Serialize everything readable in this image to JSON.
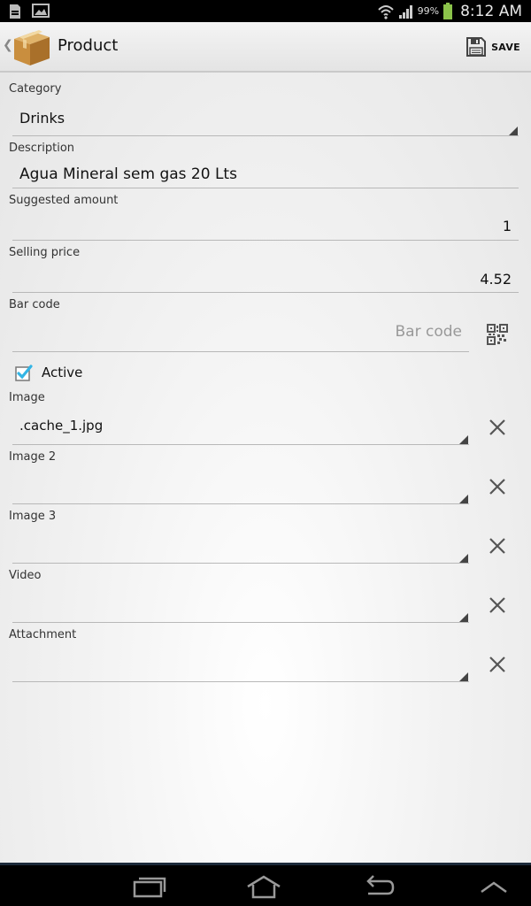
{
  "status_bar": {
    "battery_pct": "99%",
    "time": "8:12 AM",
    "icons": [
      "sim-icon",
      "gallery-icon",
      "wifi-icon",
      "signal-icon",
      "battery-icon"
    ]
  },
  "action_bar": {
    "title": "Product",
    "save_label": "SAVE",
    "icons": [
      "up-caret-icon",
      "package-box-icon",
      "save-floppy-icon"
    ]
  },
  "form": {
    "category": {
      "label": "Category",
      "value": "Drinks"
    },
    "description": {
      "label": "Description",
      "value": "Agua Mineral sem gas 20 Lts"
    },
    "suggested_amount": {
      "label": "Suggested amount",
      "value": "1"
    },
    "selling_price": {
      "label": "Selling price",
      "value": "4.52"
    },
    "bar_code": {
      "label": "Bar code",
      "placeholder": "Bar code"
    },
    "active": {
      "label": "Active",
      "checked": true
    },
    "image": {
      "label": "Image",
      "value": ".cache_1.jpg"
    },
    "image2": {
      "label": "Image 2",
      "value": ""
    },
    "image3": {
      "label": "Image 3",
      "value": ""
    },
    "video": {
      "label": "Video",
      "value": ""
    },
    "attachment": {
      "label": "Attachment",
      "value": ""
    }
  },
  "nav_bar": {
    "icons": [
      "recent-apps-icon",
      "home-icon",
      "back-icon",
      "menu-up-icon"
    ]
  },
  "colors": {
    "accent": "#33b5e5",
    "navbar": "#000000"
  }
}
